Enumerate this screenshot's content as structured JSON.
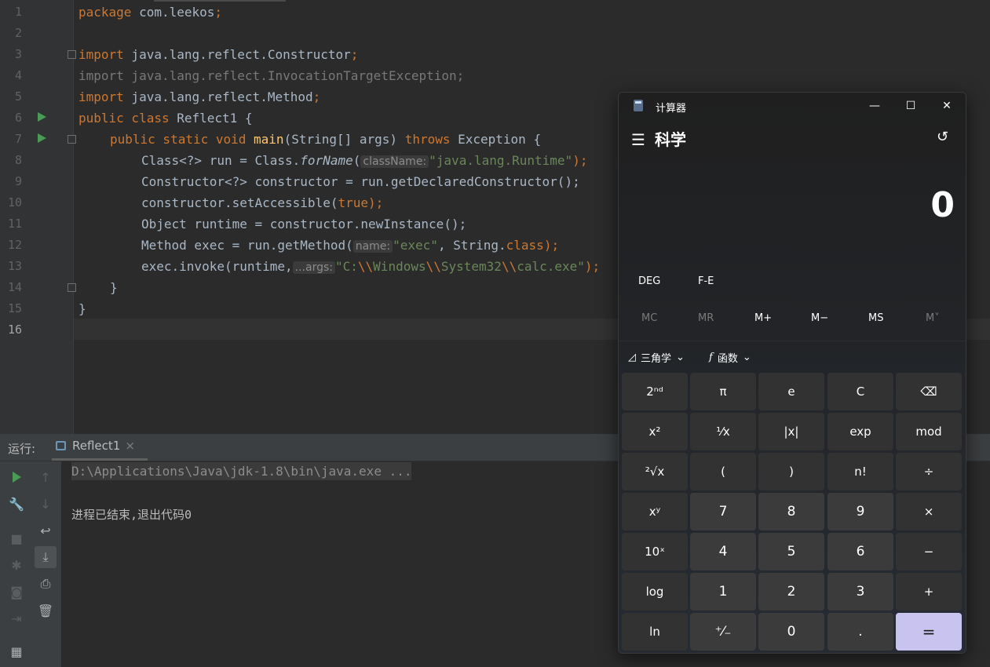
{
  "editor": {
    "line_numbers": [
      "1",
      "2",
      "3",
      "4",
      "5",
      "6",
      "7",
      "8",
      "9",
      "10",
      "11",
      "12",
      "13",
      "14",
      "15",
      "16"
    ],
    "lines": {
      "l1": {
        "kw": "package",
        "rest": " com.leekos",
        "semi": ";"
      },
      "l3": {
        "kw": "import",
        "rest": " java.lang.reflect.Constructor",
        "semi": ";"
      },
      "l4": {
        "text": "import java.lang.reflect.InvocationTargetException;"
      },
      "l5": {
        "kw": "import",
        "rest": " java.lang.reflect.Method",
        "semi": ";"
      },
      "l6": {
        "kw": "public class",
        "rest": " Reflect1 {"
      },
      "l7": {
        "kw1": "public static void",
        "fn": " main",
        "rest": "(String[] args) ",
        "kw2": "throws",
        "rest2": " Exception {"
      },
      "l8": {
        "pre": "Class<?> run = Class.",
        "it": "forName",
        "paren": "(",
        "hint": "className:",
        "str": "\"java.lang.Runtime\"",
        "end": ");"
      },
      "l9": {
        "text": "Constructor<?> constructor = run.getDeclaredConstructor();"
      },
      "l10": {
        "pre": "constructor.setAccessible(",
        "kw": "true",
        "end": ");"
      },
      "l11": {
        "text": "Object runtime = constructor.newInstance();"
      },
      "l12": {
        "pre": "Method exec = run.getMethod(",
        "hint": "name:",
        "str": "\"exec\"",
        "mid": ", String.",
        "kw": "class",
        "end": ");"
      },
      "l13": {
        "pre": "exec.invoke(runtime,",
        "hint": "...args:",
        "s1": "\"C:",
        "e1": "\\\\",
        "s2": "Windows",
        "e2": "\\\\",
        "s3": "System32",
        "e3": "\\\\",
        "s4": "calc.exe\"",
        "end": ");"
      },
      "l14": {
        "text": "}"
      },
      "l15": {
        "text": "}"
      }
    }
  },
  "run_panel": {
    "label": "运行:",
    "tab": "Reflect1",
    "command": "D:\\Applications\\Java\\jdk-1.8\\bin\\java.exe ...",
    "exit": "进程已结束,退出代码0"
  },
  "calculator": {
    "title": "计算器",
    "mode": "科学",
    "display": "0",
    "angle_unit": "DEG",
    "fe": "F-E",
    "memory": [
      "MC",
      "MR",
      "M+",
      "M−",
      "MS",
      "M˅"
    ],
    "trig_label": "三角学",
    "func_label": "函数",
    "keys": [
      "2ⁿᵈ",
      "π",
      "e",
      "C",
      "⌫",
      "x²",
      "¹⁄x",
      "|x|",
      "exp",
      "mod",
      "²√x",
      "(",
      ")",
      "n!",
      "÷",
      "xʸ",
      "7",
      "8",
      "9",
      "×",
      "10ˣ",
      "4",
      "5",
      "6",
      "−",
      "log",
      "1",
      "2",
      "3",
      "+",
      "ln",
      "⁺⁄₋",
      "0",
      ".",
      "="
    ]
  }
}
